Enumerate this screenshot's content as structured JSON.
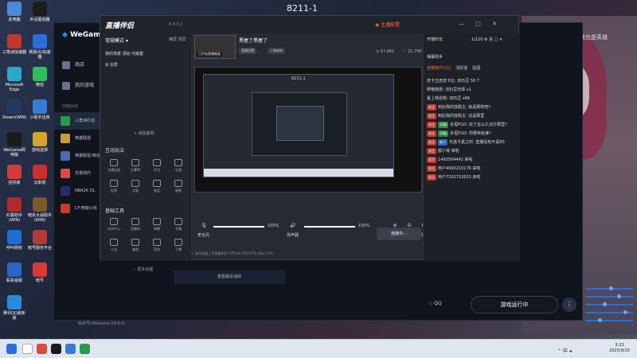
{
  "screen": {
    "top_title": "8211-1",
    "wallpaper_caption": "我也是英雄"
  },
  "desktop_icons": [
    {
      "label": "此电脑",
      "color": "#4a8ad8"
    },
    {
      "label": "外设驱动器",
      "color": "#1c1c1c"
    },
    {
      "label": "三角洲加速器",
      "color": "#c0392b"
    },
    {
      "label": "网易UU加速器",
      "color": "#2a6edc"
    },
    {
      "label": "Microsoft Edge",
      "color": "#2aa8c8"
    },
    {
      "label": "微信",
      "color": "#2fbf5a"
    },
    {
      "label": "Steam(WIN)",
      "color": "#223a5e"
    },
    {
      "label": "小助手应用",
      "color": "#3a7bd5"
    },
    {
      "label": "WeGame网吧版",
      "color": "#1b1b1b"
    },
    {
      "label": "游戏选择",
      "color": "#d4a52a"
    },
    {
      "label": "挂机锁",
      "color": "#d33b3b"
    },
    {
      "label": "云影视",
      "color": "#c9302c"
    },
    {
      "label": "红警助手(WIN)",
      "color": "#b22a2a"
    },
    {
      "label": "暗杀大战助手(WIN)",
      "color": "#7a5a2a"
    },
    {
      "label": "呼叫网管",
      "color": "#1a6ed8"
    },
    {
      "label": "暗号服务平台",
      "color": "#b23a3a"
    },
    {
      "label": "联系客服",
      "color": "#2a66c4"
    },
    {
      "label": "暗号",
      "color": "#d83a3a"
    },
    {
      "label": "腾讯QQ最新版",
      "color": "#2a8ae0"
    }
  ],
  "wegame": {
    "logo": "WeGame",
    "nav": [
      {
        "label": "商店"
      },
      {
        "label": "我的游戏"
      }
    ],
    "section": "快捷启动",
    "games": [
      {
        "label": "三角洲行动",
        "color": "#2a9a4a",
        "active": true
      },
      {
        "label": "英雄联盟",
        "color": "#c89b3c",
        "active": false
      },
      {
        "label": "英雄联盟:峡谷",
        "color": "#4a6ab8",
        "active": false
      },
      {
        "label": "无畏契约",
        "color": "#e04848",
        "active": false
      },
      {
        "label": "NBA2K OL",
        "color": "#2a2a6a",
        "active": false
      },
      {
        "label": "CF:穿越火线",
        "color": "#cc3a2a",
        "active": false
      }
    ],
    "center_button": "查看最近战绩",
    "qq_label": "QQ",
    "run_button": "游戏运行中",
    "more_button": "⋮",
    "status": "版本号(WeGame V6.0.0)"
  },
  "obs": {
    "logo": "直播伴侣",
    "version": "6.6.5.2",
    "live_badge": "主播配置",
    "window_controls": "— □ ✕",
    "left": {
      "mode": "常规模式 ▾",
      "mode_right": "横屏 竖屏",
      "scenes_tabs": "我的场景   添加   可嵌套",
      "scene_item": "⊞ 全屏",
      "add_source": "+ 添加素材",
      "interact_title": "互动玩法",
      "interact_tools": [
        "主播连麦",
        "主播PK",
        "红包",
        "礼物",
        "投票",
        "点歌",
        "抽奖",
        "福袋"
      ],
      "basic_title": "基础工具",
      "basic_tools": [
        "任务中心",
        "直播间",
        "弹幕",
        "字幕",
        "公告",
        "美颜",
        "音效",
        "下播"
      ],
      "more_functions": "··· 更多功能"
    },
    "main": {
      "thumb_label": "已开启直播画面",
      "room_title": "黑屋了黑屋了",
      "tags": [
        "直播设置",
        "人物修饰"
      ],
      "stats": [
        "⊙ 57,661",
        "♡ 21,790"
      ],
      "connect_button": "连接中…",
      "audio": [
        {
          "label": "麦克风",
          "percent": 100,
          "percent_text": "100%"
        },
        {
          "label": "扬声器",
          "percent": 100,
          "percent_text": "100%"
        }
      ],
      "audio_icons": [
        {
          "icon": "🎙"
        },
        {
          "icon": "🔊"
        },
        {
          "icon": "⊛",
          "label": "画质"
        },
        {
          "icon": "✇",
          "label": "录制"
        },
        {
          "icon": "⚙",
          "label": "设置"
        }
      ],
      "statusbar": "ⓘ 如何快速上手直播伴侣?    FPS:60   CPU:17%   内存:1:1%"
    },
    "chat": {
      "head_left": "开播时长",
      "head_right": "1/120   ⚙ 关 □ ✕",
      "helper": "弹幕助手",
      "tabs": [
        {
          "label": "全部用户(11)",
          "active": true
        },
        {
          "label": "活跃值",
          "active": false
        },
        {
          "label": "贴图",
          "active": false
        }
      ],
      "messages": [
        {
          "badges": [],
          "text": "皮卡丘皮皮卡比: 双石豆 50.7"
        },
        {
          "badges": [],
          "text": "啊哦我想: 双石豆光辉 x1"
        },
        {
          "badges": [],
          "text": "夏上林恩想: 双石豆 x66"
        },
        {
          "badges": [
            {
              "label": "关注",
              "color": "#c0392b"
            }
          ],
          "text": "到此我的放假主: 就是那样吧?"
        },
        {
          "badges": [
            {
              "label": "关注",
              "color": "#c0392b"
            }
          ],
          "text": "到此我的放假主: 这是那里"
        },
        {
          "badges": [
            {
              "label": "关注",
              "color": "#c0392b"
            },
            {
              "label": "10级",
              "color": "#2a8a4a"
            }
          ],
          "text": "永恒FGO: 玩了这么久还打那里?"
        },
        {
          "badges": [
            {
              "label": "关注",
              "color": "#c0392b"
            },
            {
              "label": "10级",
              "color": "#2a8a4a"
            }
          ],
          "text": "永恒FGO: 你要卖给谁?"
        },
        {
          "badges": [
            {
              "label": "关注",
              "color": "#c0392b"
            },
            {
              "label": "新人",
              "color": "#2a66c4"
            }
          ],
          "text": "天黑卡黑之时: 直播没有不是60"
        },
        {
          "badges": [
            {
              "label": "关注",
              "color": "#c0392b"
            }
          ],
          "text": "都小得 来啦"
        },
        {
          "badges": [
            {
              "label": "关注",
              "color": "#c0392b"
            }
          ],
          "text": "1493504442 来啦"
        },
        {
          "badges": [
            {
              "label": "关注",
              "color": "#c0392b"
            }
          ],
          "text": "用户4993210176 来啦"
        },
        {
          "badges": [
            {
              "label": "关注",
              "color": "#c0392b"
            }
          ],
          "text": "用户7202722623 来啦"
        }
      ]
    }
  },
  "taskbar": {
    "time": "3:23",
    "date": "2025/9/10",
    "tray": "⌃ 中 ◂"
  }
}
